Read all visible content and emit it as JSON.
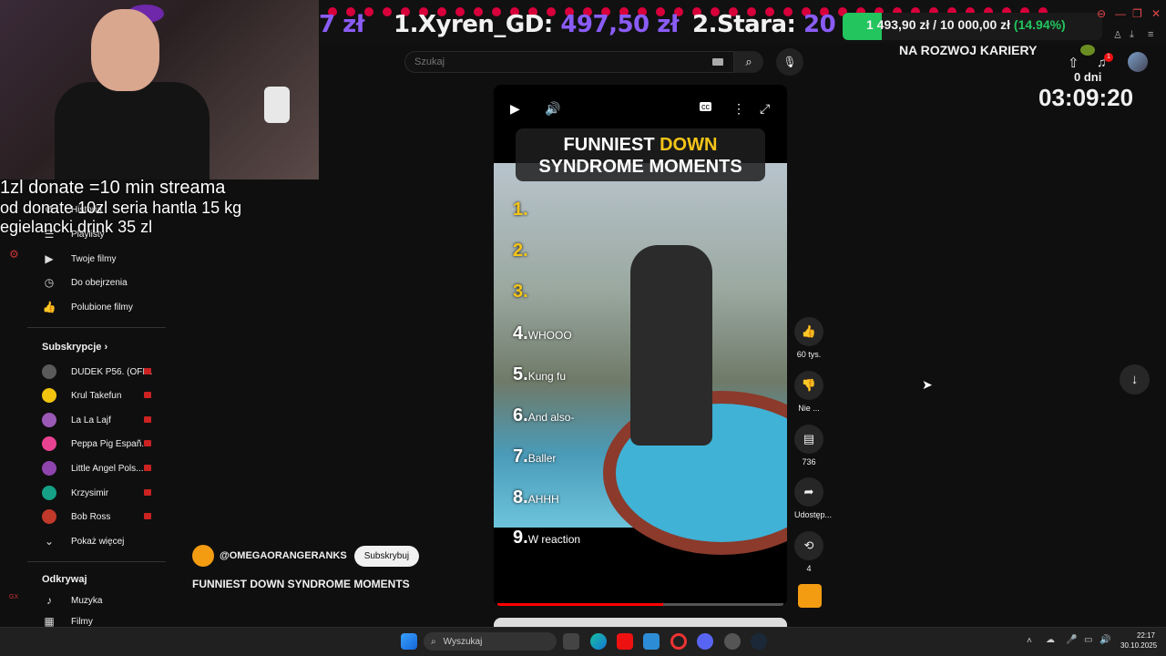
{
  "stream_overlay": {
    "leaderboard": {
      "prev_amount": "7 zł",
      "first": {
        "rank_name": "1.Xyren_GD:",
        "amount": "497,50 zł"
      },
      "second": {
        "rank_name": "2.Stara:",
        "amount": "20"
      }
    },
    "goal": {
      "current": "1 493,90 zł",
      "separator": "/",
      "target": "10 000,00 zł",
      "percent_text": "(14.94%)",
      "progress": 0.1494
    },
    "goal_label": "NA ROZWOJ KARIERY",
    "days": "0 dni",
    "timer": "03:09:20",
    "donate_lines": [
      "1zl donate =10 min streama",
      "od donate 10zl seria hantla 15 kg",
      "egielancki drink 35 zl"
    ],
    "notification_count": "1"
  },
  "youtube": {
    "search": {
      "placeholder": "Szukaj"
    },
    "sidebar": {
      "items": [
        {
          "label": "Historia",
          "icon": "history-icon"
        },
        {
          "label": "Playlisty",
          "icon": "playlist-icon"
        },
        {
          "label": "Twoje filmy",
          "icon": "video-icon"
        },
        {
          "label": "Do obejrzenia",
          "icon": "clock-icon"
        },
        {
          "label": "Polubione filmy",
          "icon": "thumbs-up-icon"
        }
      ],
      "subscriptions_heading": "Subskrypcje",
      "subscriptions": [
        {
          "label": "DUDEK P56. (OFI...",
          "color": "#5a5a5a"
        },
        {
          "label": "Krul Takefun",
          "color": "#f1c40f"
        },
        {
          "label": "La La Lajf",
          "color": "#9b59b6"
        },
        {
          "label": "Peppa Pig Españ...",
          "color": "#e84393"
        },
        {
          "label": "Little Angel Pols...",
          "color": "#8e44ad"
        },
        {
          "label": "Krzysimir",
          "color": "#16a085"
        },
        {
          "label": "Bob Ross",
          "color": "#c0392b"
        }
      ],
      "show_more": "Pokaż więcej",
      "explore_heading": "Odkrywaj",
      "explore": [
        {
          "label": "Muzyka",
          "icon": "music-icon"
        },
        {
          "label": "Filmy",
          "icon": "film-icon"
        }
      ]
    },
    "video": {
      "title_line1": "FUNNIEST",
      "title_word_highlight": "DOWN",
      "title_line2a": "SYNDROME",
      "title_line2b": "MOMENTS",
      "list": [
        {
          "num": "1.",
          "text": "",
          "highlight": true
        },
        {
          "num": "2.",
          "text": "",
          "highlight": true
        },
        {
          "num": "3.",
          "text": "",
          "highlight": true
        },
        {
          "num": "4.",
          "text": "WHOOO",
          "highlight": false
        },
        {
          "num": "5.",
          "text": "Kung fu",
          "highlight": false
        },
        {
          "num": "6.",
          "text": "And also-",
          "highlight": false
        },
        {
          "num": "7.",
          "text": "Baller",
          "highlight": false
        },
        {
          "num": "8.",
          "text": "AHHH",
          "highlight": false
        },
        {
          "num": "9.",
          "text": "W reaction",
          "highlight": false
        }
      ],
      "progress": 0.58
    },
    "actions": {
      "likes": "60 tys.",
      "dislike": "Nie ...",
      "comments": "736",
      "share": "Udostęp...",
      "remix": "4"
    },
    "channel": {
      "name": "@OMEGAORANGERANKS",
      "subscribe": "Subskrybuj"
    },
    "video_title": "FUNNIEST DOWN SYNDROME MOMENTS"
  },
  "taskbar": {
    "search_placeholder": "Wyszukaj",
    "time": "22:17",
    "date": "30.10.2025"
  }
}
